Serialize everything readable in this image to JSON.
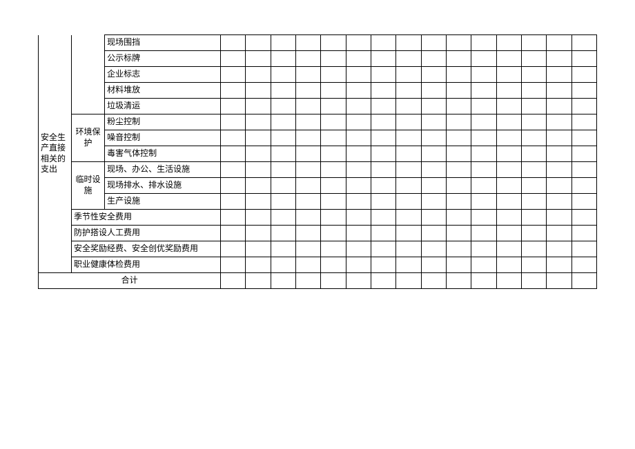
{
  "mainCategory": "安全生产直接相关的支出",
  "groups": {
    "g1": {
      "label": "",
      "items": [
        "现场围挡",
        "公示标牌",
        "企业标志",
        "材料堆放",
        "垃圾清运"
      ]
    },
    "g2": {
      "label": "环境保护",
      "items": [
        "粉尘控制",
        "噪音控制",
        "毒害气体控制"
      ]
    },
    "g3": {
      "label": "临时设施",
      "items": [
        "现场、办公、生活设施",
        "现场排水、排水设施",
        "生产设施"
      ]
    }
  },
  "spanRows": [
    "季节性安全费用",
    "防护搭设人工费用",
    "安全奖励经费、安全创优奖励费用",
    "职业健康体检费用"
  ],
  "totalLabel": "合计"
}
